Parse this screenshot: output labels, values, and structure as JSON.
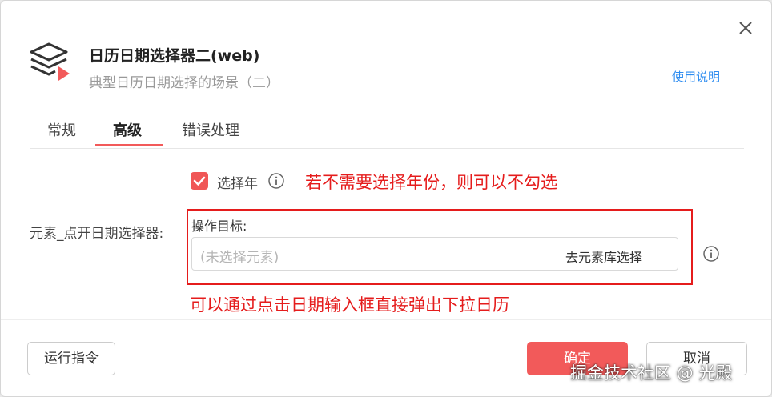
{
  "dialog": {
    "title": "日历日期选择器二(web)",
    "subtitle": "典型日历日期选择的场景（二）",
    "help_link": "使用说明"
  },
  "tabs": [
    {
      "label": "常规",
      "active": false
    },
    {
      "label": "高级",
      "active": true
    },
    {
      "label": "错误处理",
      "active": false
    }
  ],
  "options": {
    "select_year": {
      "label": "选择年",
      "checked": true
    },
    "select_year_annotation": "若不需要选择年份，则可以不勾选"
  },
  "element_field": {
    "label": "元素_点开日期选择器:",
    "target_label": "操作目标:",
    "placeholder": "(未选择元素)",
    "select_button": "去元素库选择",
    "annotation": "可以通过点击日期输入框直接弹出下拉日历"
  },
  "footer": {
    "run_button": "运行指令",
    "confirm_button": "确定",
    "cancel_button": "取消"
  },
  "watermark": "掘金技术社区 @ 光殿",
  "icons": {
    "logo": "stack-play-icon",
    "close": "close-icon",
    "info": "info-icon",
    "check": "check-icon"
  },
  "colors": {
    "accent": "#f25a5a",
    "link": "#2d8cf0",
    "annotation": "#e51c1c"
  }
}
